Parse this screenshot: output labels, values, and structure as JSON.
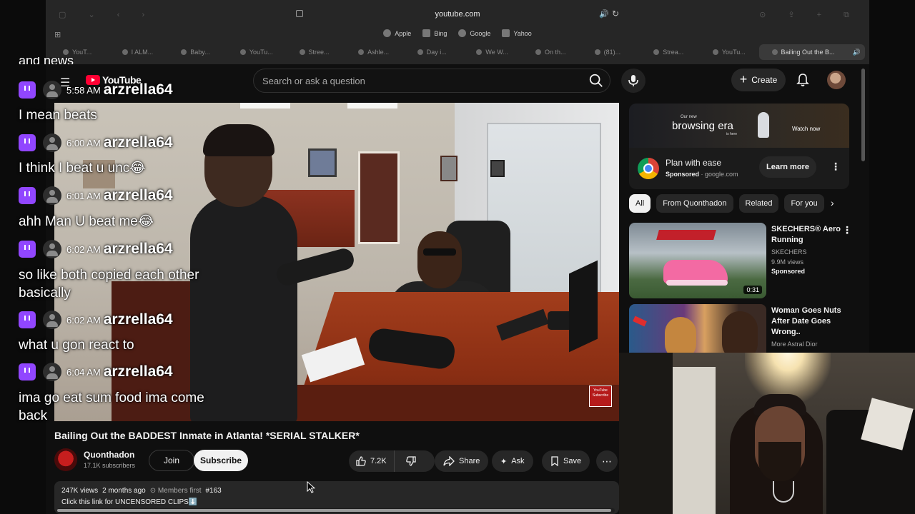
{
  "browser": {
    "url": "youtube.com",
    "favorites": [
      {
        "label": "Apple",
        "icon": "apple-icon"
      },
      {
        "label": "Bing",
        "icon": "bing-icon"
      },
      {
        "label": "Google",
        "icon": "google-icon"
      },
      {
        "label": "Yahoo",
        "icon": "yahoo-icon"
      }
    ],
    "tabs": [
      {
        "label": "YouT..."
      },
      {
        "label": "I ALM..."
      },
      {
        "label": "Baby..."
      },
      {
        "label": "YouTu..."
      },
      {
        "label": "Stree..."
      },
      {
        "label": "Ashle..."
      },
      {
        "label": "Day i..."
      },
      {
        "label": "We W..."
      },
      {
        "label": "On th..."
      },
      {
        "label": "(81)..."
      },
      {
        "label": "Strea..."
      },
      {
        "label": "YouTu..."
      },
      {
        "label": "Bailing Out the B..."
      }
    ]
  },
  "youtube": {
    "logo_text": "YouTube",
    "search_placeholder": "Search or ask a question",
    "create_label": "Create",
    "video": {
      "title": "Bailing Out the BADDEST Inmate in Atlanta! *SERIAL STALKER*",
      "channel": "Quonthadon",
      "subscribers": "17.1K subscribers",
      "join_label": "Join",
      "subscribe_label": "Subscribe",
      "likes": "7.2K",
      "share_label": "Share",
      "ask_label": "Ask",
      "save_label": "Save",
      "views": "247K views",
      "age": "2 months ago",
      "members": "Members first",
      "hashtag": "#163",
      "desc_line": "Click this link for UNCENSORED CLIPS⬇️"
    },
    "ad": {
      "banner_small": "Our new",
      "banner_big": "browsing era",
      "banner_sub": "is here",
      "banner_watch": "Watch now",
      "title": "Plan with ease",
      "sponsored": "Sponsored",
      "domain": "· google.com",
      "cta": "Learn more"
    },
    "chips": [
      "All",
      "From Quonthadon",
      "Related",
      "For you"
    ],
    "recommendations": [
      {
        "title": "SKECHERS® Aero Running",
        "channel": "SKECHERS",
        "views": "9.9M views",
        "badge": "Sponsored",
        "duration": "0:31"
      },
      {
        "title": "Woman Goes Nuts After Date Goes Wrong..",
        "channel": "More Astral Dior",
        "views": "",
        "badge": "",
        "duration": ""
      }
    ]
  },
  "chat": {
    "cut_text": "and news",
    "messages": [
      {
        "time": "5:58 AM",
        "user": "arzrella64",
        "text": "I mean beats"
      },
      {
        "time": "6:00 AM",
        "user": "arzrella64",
        "text": "I think I beat u unc😂"
      },
      {
        "time": "6:01 AM",
        "user": "arzrella64",
        "text": "ahh Man U beat me😂"
      },
      {
        "time": "6:02 AM",
        "user": "arzrella64",
        "text": "so like both copied each other basically"
      },
      {
        "time": "6:02 AM",
        "user": "arzrella64",
        "text": "what u gon react to"
      },
      {
        "time": "6:04 AM",
        "user": "arzrella64",
        "text": "ima go eat sum food ima come back"
      }
    ]
  },
  "colors": {
    "twitch": "#9146ff",
    "youtube_red": "#ff0033",
    "audio_blue": "#4a90e2"
  }
}
